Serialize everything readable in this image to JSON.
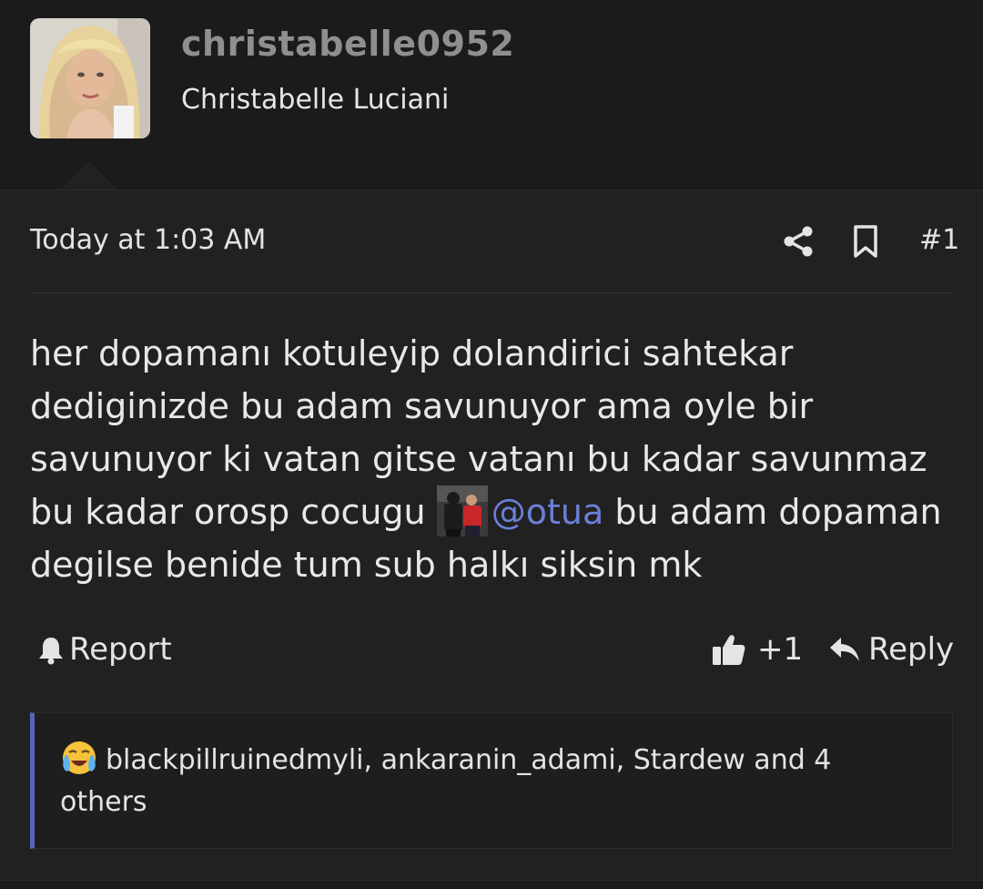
{
  "user": {
    "username": "christabelle0952",
    "display_name": "Christabelle Luciani"
  },
  "post": {
    "timestamp": "Today at 1:03 AM",
    "number": "#1",
    "message_part1": "her dopamanı kotuleyip dolandirici sahtekar dediginizde bu adam savunuyor ama oyle bir savunuyor ki vatan gitse vatanı bu kadar savunmaz bu kadar orosp cocugu ",
    "mention": "@otua",
    "message_part2": " bu adam dopaman degilse benide tum sub halkı siksin mk"
  },
  "actions": {
    "report_label": "Report",
    "like_count": "+1",
    "reply_label": "Reply"
  },
  "reactions": {
    "emoji": "loudly-crying-face",
    "text": "blackpillruinedmyli, ankaranin_adami, Stardew and 4 others"
  },
  "colors": {
    "background": "#1b1b1b",
    "post_background": "#212121",
    "mention": "#6b7fd6",
    "reaction_accent": "#5a63b8",
    "username": "#8f8f8f"
  }
}
